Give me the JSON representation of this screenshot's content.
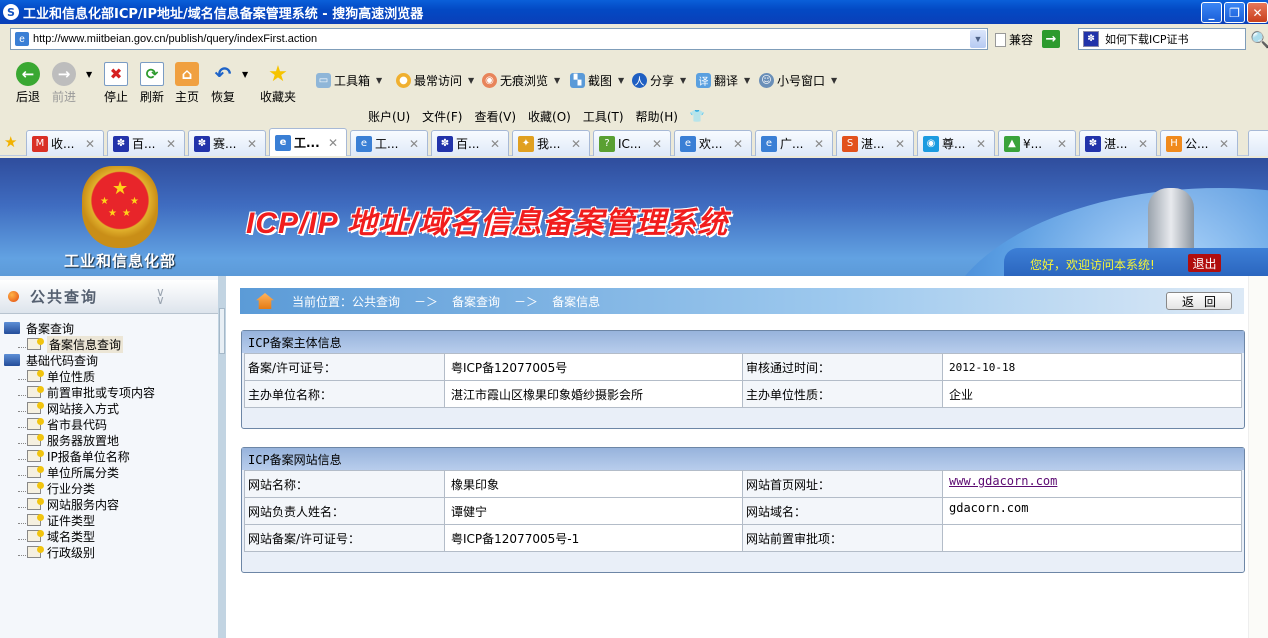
{
  "window": {
    "title": "工业和信息化部ICP/IP地址/域名信息备案管理系统 - 搜狗高速浏览器",
    "minimize": "_",
    "restore": "❐",
    "close": "✕"
  },
  "address_bar": {
    "url": "http://www.miitbeian.gov.cn/publish/query/indexFirst.action",
    "compat_label": "兼容",
    "go_icon": "→",
    "search_value": "如何下载ICP证书"
  },
  "toolbar": {
    "back": "后退",
    "forward": "前进",
    "stop": "停止",
    "refresh": "刷新",
    "home": "主页",
    "restore": "恢复",
    "favorites": "收藏夹",
    "toolbox": "工具箱",
    "most_visited": "最常访问",
    "private_browse": "无痕浏览",
    "screenshot": "截图",
    "share": "分享",
    "translate": "翻译",
    "small_window": "小号窗口"
  },
  "menubar": [
    "账户(U)",
    "文件(F)",
    "查看(V)",
    "收藏(O)",
    "工具(T)",
    "帮助(H)"
  ],
  "tabs": [
    {
      "label": "收...",
      "icon": "gmail-icon",
      "color": "#d93025",
      "glyph": "M"
    },
    {
      "label": "百...",
      "icon": "baidu-paw-icon",
      "color": "#2233aa",
      "glyph": "✽"
    },
    {
      "label": "赛...",
      "icon": "baidu-paw-icon",
      "color": "#2233aa",
      "glyph": "✽"
    },
    {
      "label": "工...",
      "icon": "ie-page-icon",
      "color": "#3a7fd5",
      "glyph": "e",
      "active": true
    },
    {
      "label": "工...",
      "icon": "ie-page-icon",
      "color": "#3a7fd5",
      "glyph": "e"
    },
    {
      "label": "百...",
      "icon": "baidu-paw-icon",
      "color": "#2233aa",
      "glyph": "✽"
    },
    {
      "label": "我...",
      "icon": "figure-icon",
      "color": "#e0a020",
      "glyph": "✦"
    },
    {
      "label": "IC...",
      "icon": "help-icon",
      "color": "#5aa032",
      "glyph": "?"
    },
    {
      "label": "欢...",
      "icon": "ie-page-icon",
      "color": "#3a7fd5",
      "glyph": "e"
    },
    {
      "label": "广...",
      "icon": "ie-page-icon",
      "color": "#3a7fd5",
      "glyph": "e"
    },
    {
      "label": "湛...",
      "icon": "sogou-s-icon",
      "color": "#e2521d",
      "glyph": "S"
    },
    {
      "label": "尊...",
      "icon": "circle-logo-icon",
      "color": "#1b9be0",
      "glyph": "◉"
    },
    {
      "label": "¥...",
      "icon": "house-arrow-icon",
      "color": "#3aa33a",
      "glyph": "▲"
    },
    {
      "label": "湛...",
      "icon": "baidu-paw-icon",
      "color": "#2233aa",
      "glyph": "✽"
    },
    {
      "label": "公...",
      "icon": "orange-logo-icon",
      "color": "#f08a1c",
      "glyph": "H"
    }
  ],
  "banner": {
    "ministry": "工业和信息化部",
    "system_title": "ICP/IP 地址/域名信息备案管理系统",
    "welcome": "您好，欢迎访问本系统!",
    "logout": "退出"
  },
  "sidebar": {
    "title": "公共查询",
    "groups": [
      {
        "label": "备案查询",
        "items": [
          {
            "label": "备案信息查询",
            "selected": true
          }
        ]
      },
      {
        "label": "基础代码查询",
        "items": [
          {
            "label": "单位性质"
          },
          {
            "label": "前置审批或专项内容"
          },
          {
            "label": "网站接入方式"
          },
          {
            "label": "省市县代码"
          },
          {
            "label": "服务器放置地"
          },
          {
            "label": "IP报备单位名称"
          },
          {
            "label": "单位所属分类"
          },
          {
            "label": "行业分类"
          },
          {
            "label": "网站服务内容"
          },
          {
            "label": "证件类型"
          },
          {
            "label": "域名类型"
          },
          {
            "label": "行政级别"
          }
        ]
      }
    ]
  },
  "breadcrumb": {
    "prefix": "当前位置：公共查询",
    "sep": "－＞",
    "level2": "备案查询",
    "level3": "备案信息",
    "back_button": "返回"
  },
  "entity_panel": {
    "title": "ICP备案主体信息",
    "rows": [
      {
        "label1": "备案/许可证号：",
        "value1": "粤ICP备12077005号",
        "label2": "审核通过时间：",
        "value2": "2012-10-18"
      },
      {
        "label1": "主办单位名称：",
        "value1": "湛江市霞山区橡果印象婚纱摄影会所",
        "label2": "主办单位性质：",
        "value2": "企业"
      }
    ]
  },
  "site_panel": {
    "title": "ICP备案网站信息",
    "rows": [
      {
        "label1": "网站名称：",
        "value1": "橡果印象",
        "label2": "网站首页网址：",
        "value2": "www.gdacorn.com"
      },
      {
        "label1": "网站负责人姓名：",
        "value1": "谭健宁",
        "label2": "网站域名：",
        "value2": "gdacorn.com"
      },
      {
        "label1": "网站备案/许可证号：",
        "value1": "粤ICP备12077005号-1",
        "label2": "网站前置审批项：",
        "value2": ""
      }
    ]
  }
}
